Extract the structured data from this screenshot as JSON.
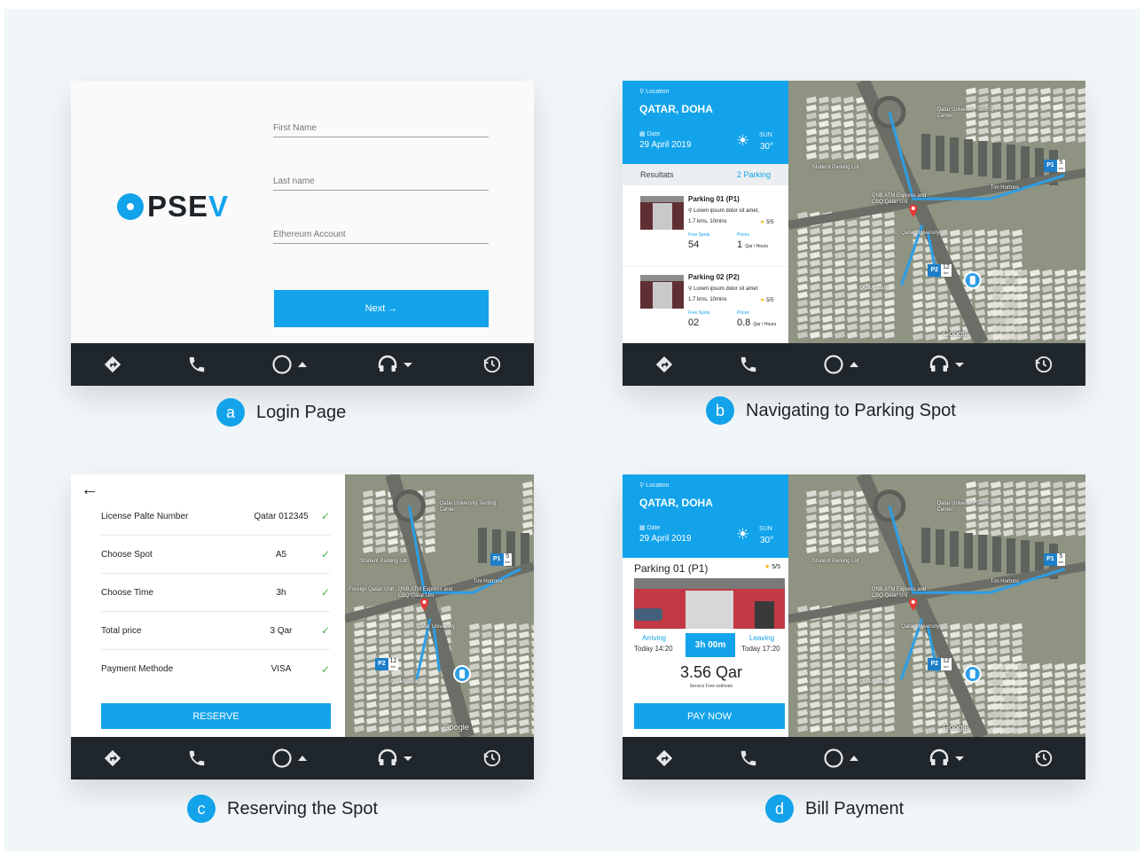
{
  "captions": [
    {
      "letter": "a",
      "text": "Login Page"
    },
    {
      "letter": "b",
      "text": "Navigating to Parking Spot"
    },
    {
      "letter": "c",
      "text": "Reserving the Spot"
    },
    {
      "letter": "d",
      "text": "Bill Payment"
    }
  ],
  "login": {
    "logo": {
      "text": "PSE",
      "accent": "V"
    },
    "fields": [
      {
        "placeholder": "First Name"
      },
      {
        "placeholder": "Last name"
      },
      {
        "placeholder": "Ethereum Account"
      }
    ],
    "next_label": "Next →"
  },
  "navbar_icons": [
    "directions-icon",
    "phone-icon",
    "home-circle-icon",
    "headphones-icon",
    "history-icon"
  ],
  "location_panel": {
    "location_label": "Location",
    "location": "QATAR, DOHA",
    "date_label": "Date",
    "date": "29 April 2019",
    "day": "SUN",
    "temp": "30°"
  },
  "results": {
    "label": "Resultats",
    "count": "2 Parking",
    "items": [
      {
        "name": "Parking 01 (P1)",
        "desc": "Lorem ipsum dolor sit amet,",
        "distance": "1.7 kms, 10mins",
        "rating": "5/5",
        "spots_label": "Free Spots",
        "spots": "54",
        "price_label": "Prices",
        "price": "1",
        "price_unit": "Qar / Hours"
      },
      {
        "name": "Parking 02 (P2)",
        "desc": "Lorem ipsum dolor sit amet",
        "distance": "1.7 kms, 10mins",
        "rating": "5/5",
        "spots_label": "Free Spots",
        "spots": "02",
        "price_label": "Prices",
        "price": "0.8",
        "price_unit": "Qar / Hours"
      }
    ]
  },
  "map": {
    "labels": [
      "Qatar University Testing Center",
      "Student Parking Lot",
      "QNB ATM Express and CBQ Qatar Uni",
      "Qatar University",
      "QU Mosque",
      "Tim Hortons",
      "Google",
      "Foreign Qatari Unit"
    ],
    "pins": [
      {
        "id": "P1",
        "distance": "5",
        "unit": "km"
      },
      {
        "id": "P2",
        "distance": "12",
        "unit": "km"
      }
    ]
  },
  "reserve": {
    "rows": [
      {
        "label": "License Palte Number",
        "value": "Qatar 012345"
      },
      {
        "label": "Choose Spot",
        "value": "A5"
      },
      {
        "label": "Choose Time",
        "value": "3h"
      },
      {
        "label": "Total price",
        "value": "3 Qar"
      },
      {
        "label": "Payment Methode",
        "value": "VISA"
      }
    ],
    "button": "RESERVE"
  },
  "bill": {
    "parking": "Parking 01 (P1)",
    "rating": "5/5",
    "arriving_label": "Arriving",
    "arriving_time": "Today 14:20",
    "duration": "3h 00m",
    "leaving_label": "Leaving",
    "leaving_time": "Today 17:20",
    "total": "3.56 Qar",
    "note": "Service Free estimate",
    "button": "PAY NOW"
  },
  "colors": {
    "accent": "#12a3eb",
    "navbar": "#1f262c",
    "route": "#2d9ee6",
    "pin": "#e53935",
    "check": "#4caf50"
  }
}
